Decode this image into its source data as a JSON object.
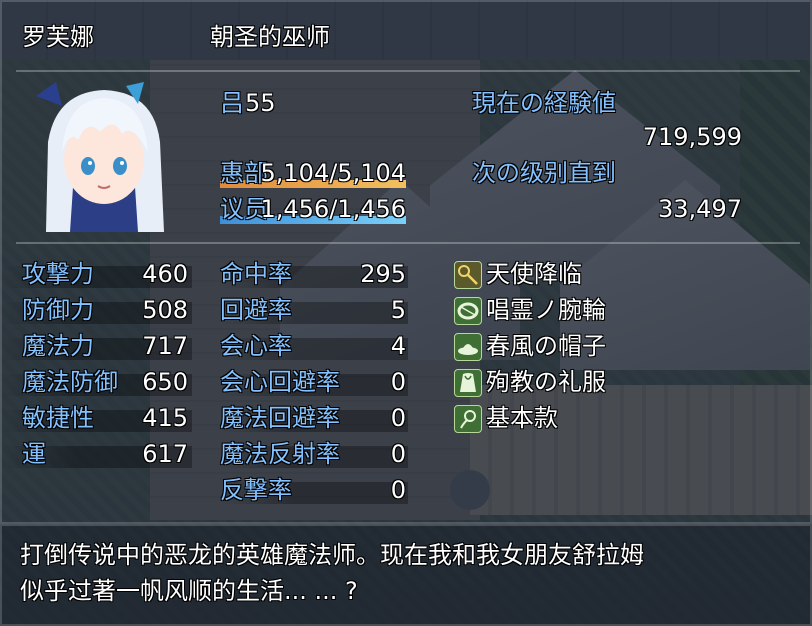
{
  "actor": {
    "name": "罗芙娜",
    "class": "朝圣的巫师",
    "level_label": "吕",
    "level": "55",
    "hp_label": "惠部",
    "hp_value": "5,104/5,104",
    "hp_ratio": 1.0,
    "mp_label": "议员",
    "mp_value": "1,456/1,456",
    "mp_ratio": 1.0
  },
  "exp": {
    "current_label": "現在の経験値",
    "current_value": "719,599",
    "next_label": "次の级别直到",
    "next_value": "33,497"
  },
  "params": [
    {
      "label": "攻撃力",
      "value": "460"
    },
    {
      "label": "防御力",
      "value": "508"
    },
    {
      "label": "魔法力",
      "value": "717"
    },
    {
      "label": "魔法防御",
      "value": "650"
    },
    {
      "label": "敏捷性",
      "value": "415"
    },
    {
      "label": "運",
      "value": "617"
    }
  ],
  "xparams": [
    {
      "label": "命中率",
      "value": "295"
    },
    {
      "label": "回避率",
      "value": "5"
    },
    {
      "label": "会心率",
      "value": "4"
    },
    {
      "label": "会心回避率",
      "value": "0"
    },
    {
      "label": "魔法回避率",
      "value": "0"
    },
    {
      "label": "魔法反射率",
      "value": "0"
    },
    {
      "label": "反撃率",
      "value": "0"
    }
  ],
  "equips": [
    {
      "name": "天使降临",
      "icon": "staff-icon"
    },
    {
      "name": "唱霊ノ腕輪",
      "icon": "bracelet-icon"
    },
    {
      "name": "春風の帽子",
      "icon": "hat-icon"
    },
    {
      "name": "殉教の礼服",
      "icon": "robe-icon"
    },
    {
      "name": "基本款",
      "icon": "accessory-icon"
    }
  ],
  "profile": {
    "line1": "打倒传说中的恶龙的英雄魔法师。现在我和我女朋友舒拉姆",
    "line2": "似乎过著一帆风顺的生活... ... ?"
  },
  "colors": {
    "system_text": "#84c1ff",
    "hp_gauge": "#e08a3c",
    "mp_gauge": "#3e8fd8",
    "window_bg": "#20283a"
  }
}
